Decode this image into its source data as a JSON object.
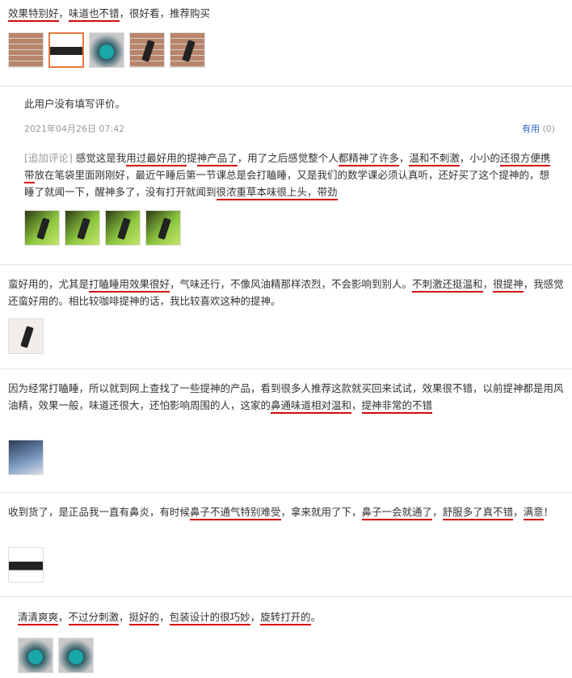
{
  "reviews": [
    {
      "text_parts": [
        {
          "t": "效果特别好",
          "u": true
        },
        {
          "t": "，"
        },
        {
          "t": "味道也不错",
          "u": true
        },
        {
          "t": "，很好看，推荐购买"
        }
      ],
      "images": [
        "brick",
        "dark",
        "teal",
        "brick-stick",
        "brick-stick"
      ]
    },
    {
      "text": "此用户没有填写评价。",
      "date": "2021年04月26日 07:42",
      "useful_label": "有用",
      "useful_count": "(0)",
      "additional": {
        "tag": "[追加评论]",
        "parts": [
          {
            "t": " 感觉这是我"
          },
          {
            "t": "用过最好用的",
            "u": true
          },
          {
            "t": "提"
          },
          {
            "t": "神产品了",
            "u": true
          },
          {
            "t": "，用了之后感觉整个人"
          },
          {
            "t": "都精神了许多",
            "u": true
          },
          {
            "t": "，"
          },
          {
            "t": "温和不刺激",
            "u": true
          },
          {
            "t": "，小小的"
          },
          {
            "t": "还很方便携带",
            "u": true
          },
          {
            "t": "放在笔袋里面刚刚好，最近午睡后第一节课总是会打瞌睡，又是我们的数学课必须认真听，还好买了这个提神的，想睡了就闻一下，醒神多了，没有打开就闻到"
          },
          {
            "t": "很浓重草本味很上头，带劲",
            "u": true
          }
        ]
      },
      "images": [
        "green-stick",
        "green-stick",
        "green-stick",
        "green-stick"
      ]
    },
    {
      "text_parts": [
        {
          "t": "蛮好用的，尤其是"
        },
        {
          "t": "打瞌睡用效果很好",
          "u": true
        },
        {
          "t": "，气味还行，不像风油精那样浓烈，不会影响到别人。"
        },
        {
          "t": "不刺激还挺温和",
          "u": true
        },
        {
          "t": "，"
        },
        {
          "t": "很提神",
          "u": true
        },
        {
          "t": "，我感觉还蛮好用的。相比较咖啡提神的话，我比较喜欢这种的提神。"
        }
      ],
      "images": [
        "pale-stick"
      ]
    },
    {
      "text_parts": [
        {
          "t": "因为经常打瞌睡，所以就到网上查找了一些提神的产品，看到很多人推荐这款就买回来试试，效果很不错，以前提神都是用风油精，效果一般，味道还很大，还怕影响周围的人，这家的"
        },
        {
          "t": "鼻通味道相对温和",
          "u": true
        },
        {
          "t": "，"
        },
        {
          "t": "提神非常的不错",
          "u": true
        }
      ],
      "images": [
        "blueish"
      ]
    },
    {
      "text_parts": [
        {
          "t": "收到货了，是正品我一直有鼻炎，有时候"
        },
        {
          "t": "鼻子不通气特别难受",
          "u": true
        },
        {
          "t": "，拿来就用了下，"
        },
        {
          "t": "鼻子一会就通了",
          "u": true
        },
        {
          "t": "，"
        },
        {
          "t": "舒服多了真不错",
          "u": true
        },
        {
          "t": "，"
        },
        {
          "t": "满意",
          "u": true
        },
        {
          "t": "！"
        }
      ],
      "images": [
        "dark"
      ]
    },
    {
      "text_parts": [
        {
          "t": "清清爽爽",
          "u": true
        },
        {
          "t": "，"
        },
        {
          "t": "不过分刺激",
          "u": true
        },
        {
          "t": "，"
        },
        {
          "t": "挺好的",
          "u": true
        },
        {
          "t": "，"
        },
        {
          "t": "包装设计的很巧妙",
          "u": true
        },
        {
          "t": "，"
        },
        {
          "t": "旋转打开的",
          "u": true
        },
        {
          "t": "。"
        }
      ],
      "images": [
        "teal",
        "teal"
      ]
    }
  ]
}
